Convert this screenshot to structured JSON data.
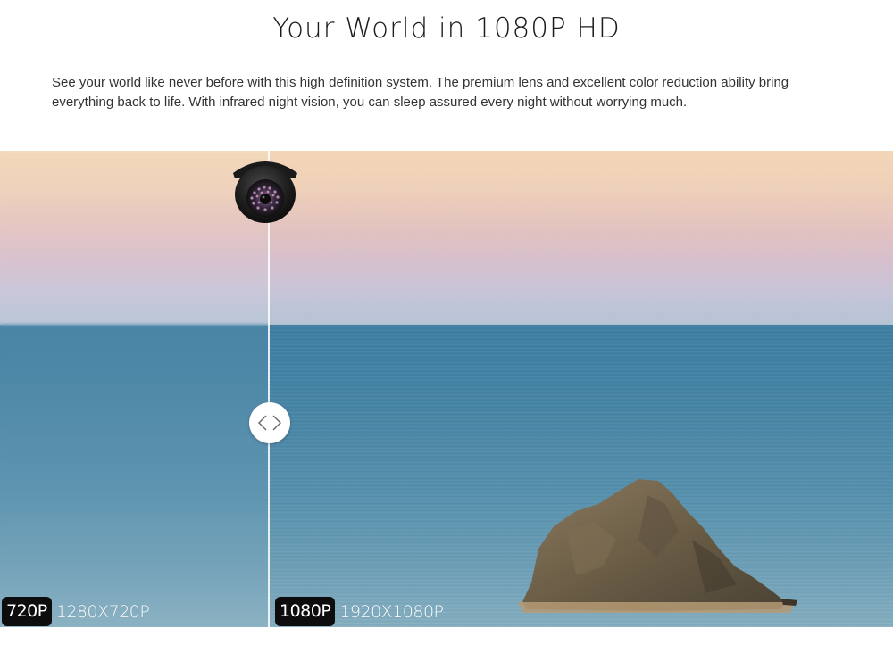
{
  "heading": {
    "title": "Your World in 1080P HD",
    "description": "See your world like never before with this high definition system. The premium lens and excellent color reduction ability bring everything back to life. With infrared night vision, you can sleep assured every night without worrying much."
  },
  "comparison": {
    "left": {
      "badge": "720P",
      "resolution": "1280X720P"
    },
    "right": {
      "badge": "1080P",
      "resolution": "1920X1080P"
    },
    "handle_icon": "left-right-arrows-icon",
    "camera_icon": "dome-camera-icon"
  },
  "colors": {
    "badge_bg": "#0d0d0d",
    "text": "#333333",
    "sea": "#4684a6",
    "sky_top": "#f3d6b7"
  }
}
